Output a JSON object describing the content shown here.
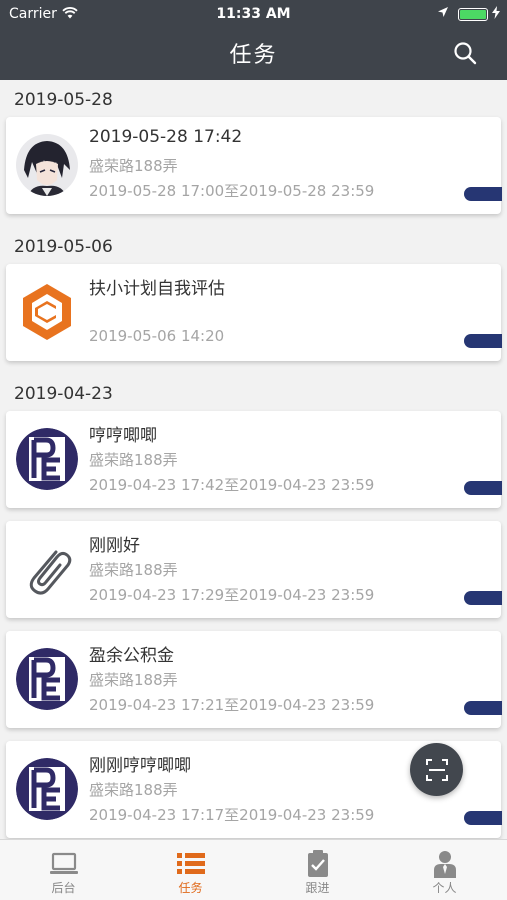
{
  "status_bar": {
    "carrier": "Carrier",
    "time": "11:33 AM",
    "icons": [
      "wifi-icon",
      "location-arrow-icon",
      "battery-icon",
      "charging-bolt-icon"
    ]
  },
  "header": {
    "title": "任务",
    "search_icon": "search-icon"
  },
  "groups": [
    {
      "date": "2019-05-28",
      "items": [
        {
          "title": "2019-05-28 17:42",
          "location": "盛荣路188弄",
          "time_range": "2019-05-28 17:00至2019-05-28 23:59",
          "thumb": "anime-avatar"
        }
      ]
    },
    {
      "date": "2019-05-06",
      "items": [
        {
          "title": "扶小计划自我评估",
          "location": "",
          "time_range": "2019-05-06 14:20",
          "thumb": "hexagon-logo"
        }
      ]
    },
    {
      "date": "2019-04-23",
      "items": [
        {
          "title": "哼哼唧唧",
          "location": "盛荣路188弄",
          "time_range": "2019-04-23 17:42至2019-04-23 23:59",
          "thumb": "pe-logo"
        },
        {
          "title": "刚刚好",
          "location": "盛荣路188弄",
          "time_range": "2019-04-23 17:29至2019-04-23 23:59",
          "thumb": "paperclip-icon"
        },
        {
          "title": "盈余公积金",
          "location": "盛荣路188弄",
          "time_range": "2019-04-23 17:21至2019-04-23 23:59",
          "thumb": "pe-logo"
        },
        {
          "title": "刚刚哼哼唧唧",
          "location": "盛荣路188弄",
          "time_range": "2019-04-23 17:17至2019-04-23 23:59",
          "thumb": "pe-logo"
        }
      ]
    }
  ],
  "scan_button": {
    "icon": "scan-icon"
  },
  "tabbar": {
    "tabs": [
      {
        "label": "后台",
        "icon": "laptop-icon",
        "active": false
      },
      {
        "label": "任务",
        "icon": "task-list-icon",
        "active": true
      },
      {
        "label": "跟进",
        "icon": "clipboard-check-icon",
        "active": false
      },
      {
        "label": "个人",
        "icon": "person-icon",
        "active": false
      }
    ]
  },
  "colors": {
    "header_bg": "#3f444b",
    "accent": "#e06a1b",
    "status_tab": "#263673",
    "secondary_text": "#a5a5a5"
  }
}
